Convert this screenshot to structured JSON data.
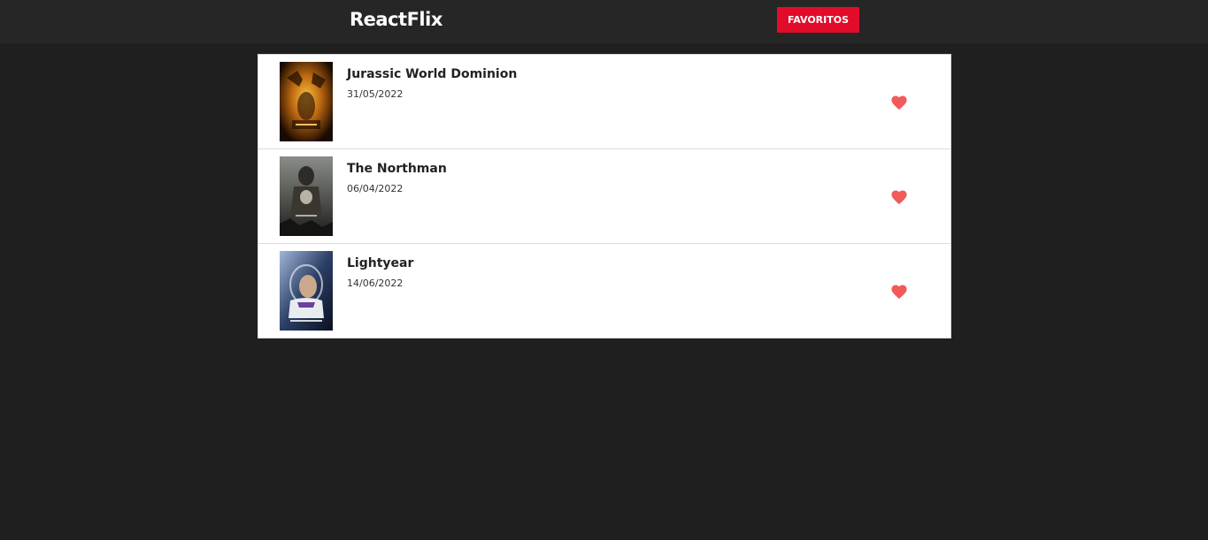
{
  "header": {
    "logo": "ReactFlix",
    "favorites_label": "FAVORITOS"
  },
  "colors": {
    "header_bg": "#262626",
    "page_bg": "#1f1f1f",
    "accent_red": "#e30b2a",
    "heart": "#f25a5a"
  },
  "movies": [
    {
      "title": "Jurassic World Dominion",
      "date": "31/05/2022",
      "poster_icon": "jurassic-world-poster",
      "favorite_icon": "heart-icon"
    },
    {
      "title": "The Northman",
      "date": "06/04/2022",
      "poster_icon": "the-northman-poster",
      "favorite_icon": "heart-icon"
    },
    {
      "title": "Lightyear",
      "date": "14/06/2022",
      "poster_icon": "lightyear-poster",
      "favorite_icon": "heart-icon"
    }
  ]
}
